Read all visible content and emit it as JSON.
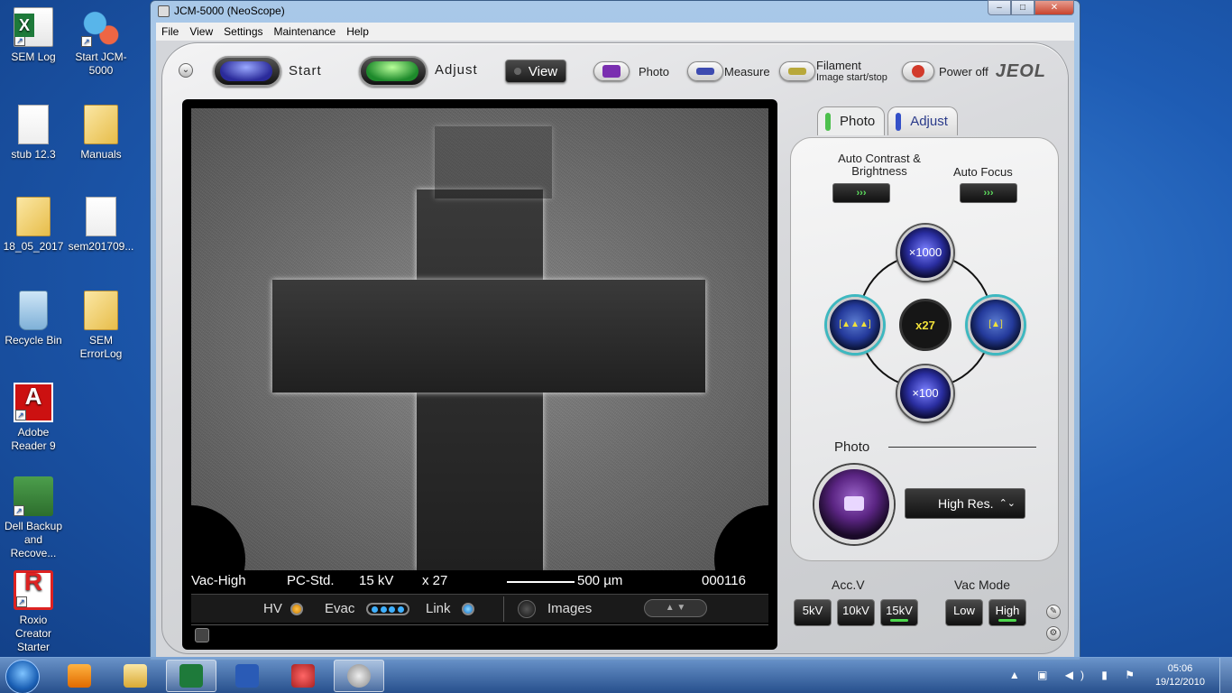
{
  "desktop": {
    "icons": [
      {
        "label": "SEM Log",
        "icon": "excel-shortcut-icon"
      },
      {
        "label": "Start JCM-5000",
        "icon": "jcm-gear-icon"
      },
      {
        "label": "stub 12.3",
        "icon": "text-document-icon"
      },
      {
        "label": "Manuals",
        "icon": "folder-icon"
      },
      {
        "label": "18_05_2017",
        "icon": "folder-icon"
      },
      {
        "label": "sem201709...",
        "icon": "text-document-icon"
      },
      {
        "label": "Recycle Bin",
        "icon": "recycle-bin-icon"
      },
      {
        "label": "SEM ErrorLog",
        "icon": "folder-icon"
      },
      {
        "label": "Adobe Reader 9",
        "icon": "adobe-reader-icon"
      },
      {
        "label": "Dell Backup and Recove...",
        "icon": "dell-backup-icon"
      },
      {
        "label": "Roxio Creator Starter",
        "icon": "roxio-icon"
      }
    ]
  },
  "window": {
    "title": "JCM-5000 (NeoScope)",
    "controls": {
      "minimize": "–",
      "maximize": "□",
      "close": "✕"
    },
    "menu": [
      "File",
      "View",
      "Settings",
      "Maintenance",
      "Help"
    ]
  },
  "toolbar": {
    "start_label": "Start",
    "adjust_label": "Adjust",
    "view_label": "View",
    "photo_label": "Photo",
    "measure_label": "Measure",
    "filament_label": "Filament",
    "filament_sub": "Image start/stop",
    "poweroff_label": "Power off",
    "brand": "JEOL"
  },
  "image": {
    "vacuum": "Vac-High",
    "mode": "PC-Std.",
    "voltage": "15 kV",
    "magnification": "x 27",
    "scale": "500 µm",
    "image_number": "000116"
  },
  "status": {
    "hv_label": "HV",
    "evac_label": "Evac",
    "link_label": "Link",
    "images_label": "Images"
  },
  "panel": {
    "tabs": [
      "Photo",
      "Adjust"
    ],
    "active_tab": "Photo",
    "auto_contrast_label": "Auto Contrast & Brightness",
    "auto_focus_label": "Auto Focus",
    "run_glyph": "›››",
    "mag_top": "×1000",
    "mag_bottom": "×100",
    "mag_current": "x27",
    "zoom_out_glyph": "[▲▲▲]",
    "zoom_in_glyph": "[▲]",
    "photo_section_label": "Photo",
    "resolution_value": "High Res.",
    "resolution_arrows": "⌃⌄"
  },
  "accv": {
    "label": "Acc.V",
    "options": [
      "5kV",
      "10kV",
      "15kV"
    ],
    "selected": "15kV"
  },
  "vacmode": {
    "label": "Vac Mode",
    "options": [
      "Low",
      "High"
    ],
    "selected": "High"
  },
  "taskbar": {
    "time": "05:06",
    "date": "19/12/2010"
  }
}
